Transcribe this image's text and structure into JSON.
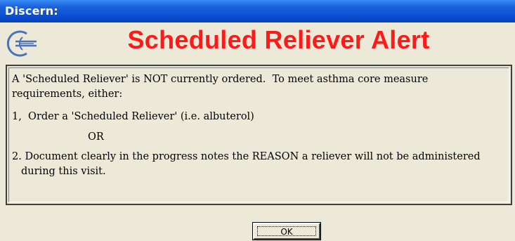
{
  "window": {
    "title": "Discern:",
    "title_bar_color": "#0a4fd3",
    "background_color": "#ece9d8"
  },
  "alert": {
    "logo_icon": "discern-logo-icon",
    "title": "Scheduled Reliever Alert",
    "title_color": "#ff1a1a"
  },
  "message": {
    "intro_line1": "A 'Scheduled Reliever' is NOT currently ordered.  To meet asthma core measure",
    "intro_line2": "requirements, either:",
    "option1": "1,  Order a 'Scheduled Reliever' (i.e. albuterol)",
    "or_text": "OR",
    "option2_line1": "2. Document clearly in the progress notes the REASON a reliever will not be administered",
    "option2_line2": "during this visit."
  },
  "buttons": {
    "ok_label": "OK"
  }
}
